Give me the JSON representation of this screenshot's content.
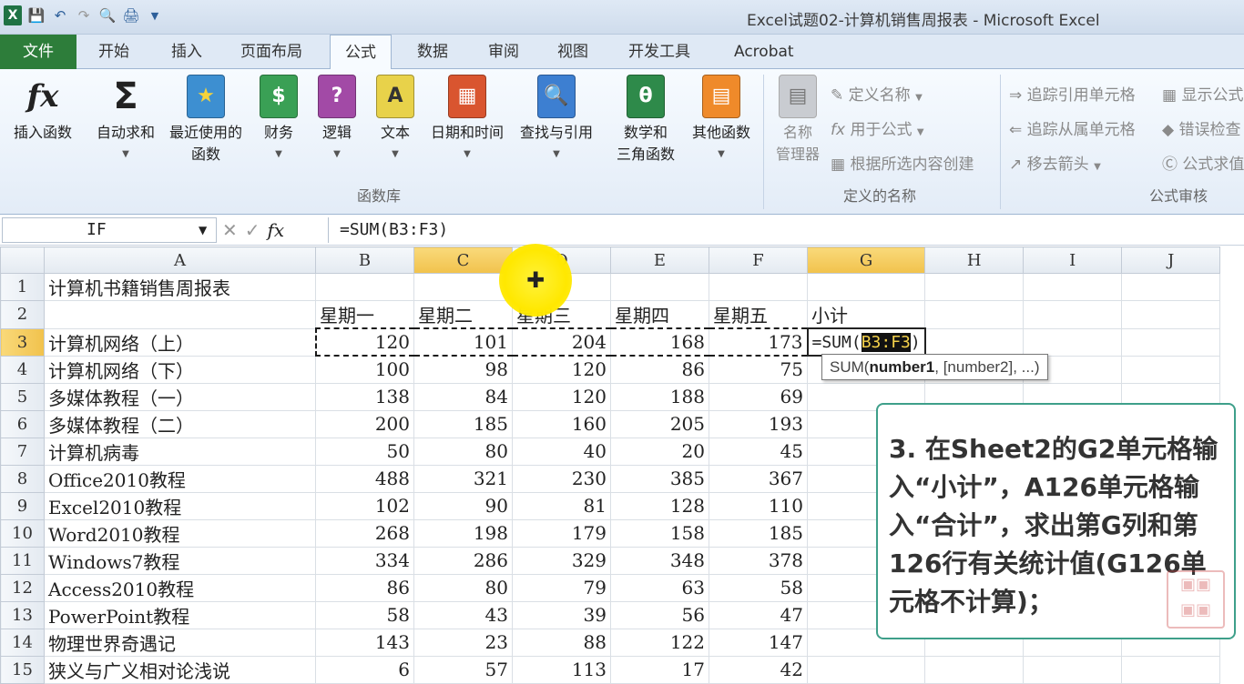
{
  "window": {
    "title": "Excel试题02-计算机销售周报表  -  Microsoft Excel"
  },
  "qat": {
    "icons": [
      "excel-logo-icon",
      "save-icon",
      "undo-icon",
      "redo-icon",
      "print-preview-icon",
      "quick-print-icon",
      "customize-icon"
    ]
  },
  "tabs": [
    {
      "label": "文件"
    },
    {
      "label": "开始"
    },
    {
      "label": "插入"
    },
    {
      "label": "页面布局"
    },
    {
      "label": "公式",
      "active": true
    },
    {
      "label": "数据"
    },
    {
      "label": "审阅"
    },
    {
      "label": "视图"
    },
    {
      "label": "开发工具"
    },
    {
      "label": "Acrobat"
    }
  ],
  "ribbon": {
    "function_library": {
      "group_label": "函数库",
      "insert_function": "插入函数",
      "autosum": "自动求和",
      "recent_1": "最近使用的",
      "recent_2": "函数",
      "financial": "财务",
      "logical": "逻辑",
      "text": "文本",
      "datetime": "日期和时间",
      "lookup": "查找与引用",
      "math_1": "数学和",
      "math_2": "三角函数",
      "more": "其他函数"
    },
    "defined_names": {
      "group_label": "定义的名称",
      "name_manager_1": "名称",
      "name_manager_2": "管理器",
      "define_name": "定义名称",
      "use_in_formula": "用于公式",
      "create_from_selection": "根据所选内容创建"
    },
    "auditing": {
      "group_label": "公式审核",
      "trace_precedents": "追踪引用单元格",
      "trace_dependents": "追踪从属单元格",
      "remove_arrows": "移去箭头",
      "show_formulas": "显示公式",
      "error_checking": "错误检查",
      "evaluate_formula": "公式求值"
    }
  },
  "formula_bar": {
    "name_box": "IF",
    "formula": "=SUM(B3:F3)",
    "fx": "fx"
  },
  "sheet": {
    "columns": [
      "A",
      "B",
      "C",
      "D",
      "E",
      "F",
      "G",
      "H",
      "I",
      "J"
    ],
    "rows": [
      {
        "n": "1",
        "cells": [
          "计算机书籍销售周报表",
          "",
          "",
          "",
          "",
          "",
          "",
          "",
          "",
          ""
        ]
      },
      {
        "n": "2",
        "cells": [
          "",
          "星期一",
          "星期二",
          "星期三",
          "星期四",
          "星期五",
          "小计",
          "",
          "",
          ""
        ]
      },
      {
        "n": "3",
        "cells": [
          "计算机网络（上）",
          "120",
          "101",
          "204",
          "168",
          "173",
          "",
          "",
          "",
          ""
        ]
      },
      {
        "n": "4",
        "cells": [
          "计算机网络（下）",
          "100",
          "98",
          "120",
          "86",
          "75",
          "",
          "",
          "",
          ""
        ]
      },
      {
        "n": "5",
        "cells": [
          "多媒体教程（一）",
          "138",
          "84",
          "120",
          "188",
          "69",
          "",
          "",
          "",
          ""
        ]
      },
      {
        "n": "6",
        "cells": [
          "多媒体教程（二）",
          "200",
          "185",
          "160",
          "205",
          "193",
          "",
          "",
          "",
          ""
        ]
      },
      {
        "n": "7",
        "cells": [
          "计算机病毒",
          "50",
          "80",
          "40",
          "20",
          "45",
          "",
          "",
          "",
          ""
        ]
      },
      {
        "n": "8",
        "cells": [
          "Office2010教程",
          "488",
          "321",
          "230",
          "385",
          "367",
          "",
          "",
          "",
          ""
        ]
      },
      {
        "n": "9",
        "cells": [
          "Excel2010教程",
          "102",
          "90",
          "81",
          "128",
          "110",
          "",
          "",
          "",
          ""
        ]
      },
      {
        "n": "10",
        "cells": [
          "Word2010教程",
          "268",
          "198",
          "179",
          "158",
          "185",
          "",
          "",
          "",
          ""
        ]
      },
      {
        "n": "11",
        "cells": [
          "Windows7教程",
          "334",
          "286",
          "329",
          "348",
          "378",
          "",
          "",
          "",
          ""
        ]
      },
      {
        "n": "12",
        "cells": [
          "Access2010教程",
          "86",
          "80",
          "79",
          "63",
          "58",
          "",
          "",
          "",
          ""
        ]
      },
      {
        "n": "13",
        "cells": [
          "PowerPoint教程",
          "58",
          "43",
          "39",
          "56",
          "47",
          "",
          "",
          "",
          ""
        ]
      },
      {
        "n": "14",
        "cells": [
          "物理世界奇遇记",
          "143",
          "23",
          "88",
          "122",
          "147",
          "",
          "",
          "",
          ""
        ]
      },
      {
        "n": "15",
        "cells": [
          "狭义与广义相对论浅说",
          "6",
          "57",
          "113",
          "17",
          "42",
          "",
          "",
          "",
          ""
        ]
      }
    ],
    "editing_cell": {
      "prefix": "=SUM(",
      "ref": "B3:F3",
      "suffix": ")"
    }
  },
  "tooltip": {
    "func": "SUM(",
    "arg1": "number1",
    "rest": ", [number2], ...)"
  },
  "note": {
    "text": "3. 在Sheet2的G2单元格输入“小计”，A126单元格输入“合计”，求出第G列和第126行有关统计值(G126单元格不计算)；"
  },
  "colors": {
    "accent": "#2d7d3a",
    "selection_header": "#f1c24c",
    "note_border": "#3e9f8a",
    "cursor": "#ffe800"
  }
}
